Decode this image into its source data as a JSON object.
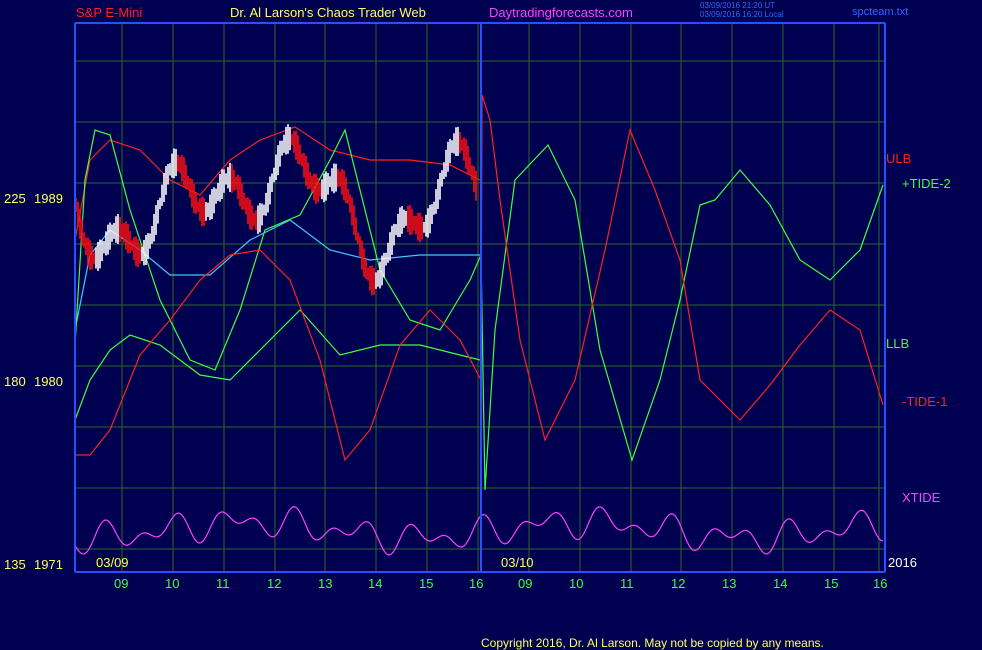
{
  "header": {
    "instrument": "S&P E-Mini",
    "site_title": "Dr. Al Larson's Chaos Trader Web",
    "site_url": "Daytradingforecasts.com",
    "timestamp_ut": "03/09/2016 21:20 UT",
    "timestamp_local": "03/09/2016 16:20 Local",
    "file_name": "spcteam.txt"
  },
  "footer": {
    "copyright": "Copyright 2016, Dr. Al Larson. May not be copied by any means."
  },
  "chart_data": {
    "type": "line",
    "y_axis_labels": [
      {
        "left": "225",
        "right": "1989",
        "price": 1989
      },
      {
        "left": "180",
        "right": "1980",
        "price": 1980
      },
      {
        "left": "135",
        "right": "1971",
        "price": 1971
      }
    ],
    "ylim": [
      1971,
      1999
    ],
    "x_ticks": [
      "09",
      "10",
      "11",
      "12",
      "13",
      "14",
      "15",
      "16",
      "09",
      "10",
      "11",
      "12",
      "13",
      "14",
      "15",
      "16"
    ],
    "date_labels": [
      "03/09",
      "03/10",
      "2016"
    ],
    "grid": true,
    "series": [
      {
        "name": "ULB",
        "color": "#ff2020"
      },
      {
        "name": "+TIDE-2",
        "color": "#40ff40"
      },
      {
        "name": "LLB",
        "color": "#40ff40"
      },
      {
        "name": "-TIDE-1",
        "color": "#ff2020"
      },
      {
        "name": "XTIDE",
        "color": "#ff40ff"
      }
    ]
  }
}
